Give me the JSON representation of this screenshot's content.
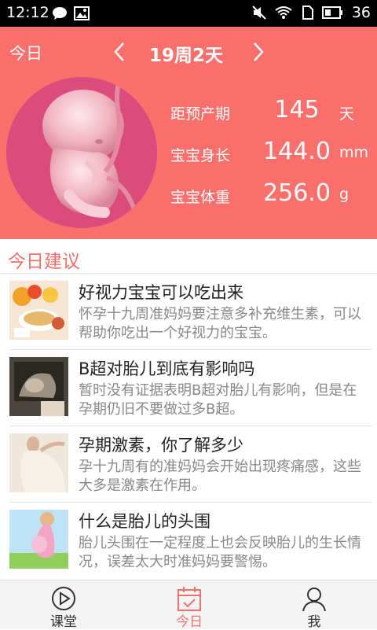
{
  "status_bar": {
    "time": "12:12",
    "battery_level": "36",
    "icons": [
      "chat-icon",
      "image-icon",
      "mute-icon",
      "wifi-icon",
      "sim-icon",
      "battery-icon"
    ]
  },
  "header": {
    "today_label": "今日",
    "week_label": "19周2天",
    "stats": [
      {
        "label": "距预产期",
        "value": "145",
        "unit": "天"
      },
      {
        "label": "宝宝身长",
        "value": "144.0",
        "unit": "mm"
      },
      {
        "label": "宝宝体重",
        "value": "256.0",
        "unit": "g"
      }
    ],
    "accent_color": "#f96f6b"
  },
  "section": {
    "title": "今日建议"
  },
  "articles": [
    {
      "title": "好视力宝宝可以吃出来",
      "desc": "怀孕十九周准妈妈要注意多补充维生素，可以帮助你吃出一个好视力的宝宝。"
    },
    {
      "title": "B超对胎儿到底有影响吗",
      "desc": "暂时没有证据表明B超对胎儿有影响，但是在孕期仍旧不要做过多B超。"
    },
    {
      "title": "孕期激素，你了解多少",
      "desc": "孕十九周有的准妈妈会开始出现疼痛感，这些大多是激素在作用。"
    },
    {
      "title": "什么是胎儿的头围",
      "desc": "胎儿头围在一定程度上也会反映胎儿的生长情况，误差太大时准妈妈要警惕。"
    }
  ],
  "bottom_nav": {
    "tabs": [
      {
        "label": "课堂",
        "icon": "play-circle-icon"
      },
      {
        "label": "今日",
        "icon": "calendar-check-icon",
        "active": true
      },
      {
        "label": "我",
        "icon": "user-icon"
      }
    ],
    "active_color": "#f2706b"
  }
}
